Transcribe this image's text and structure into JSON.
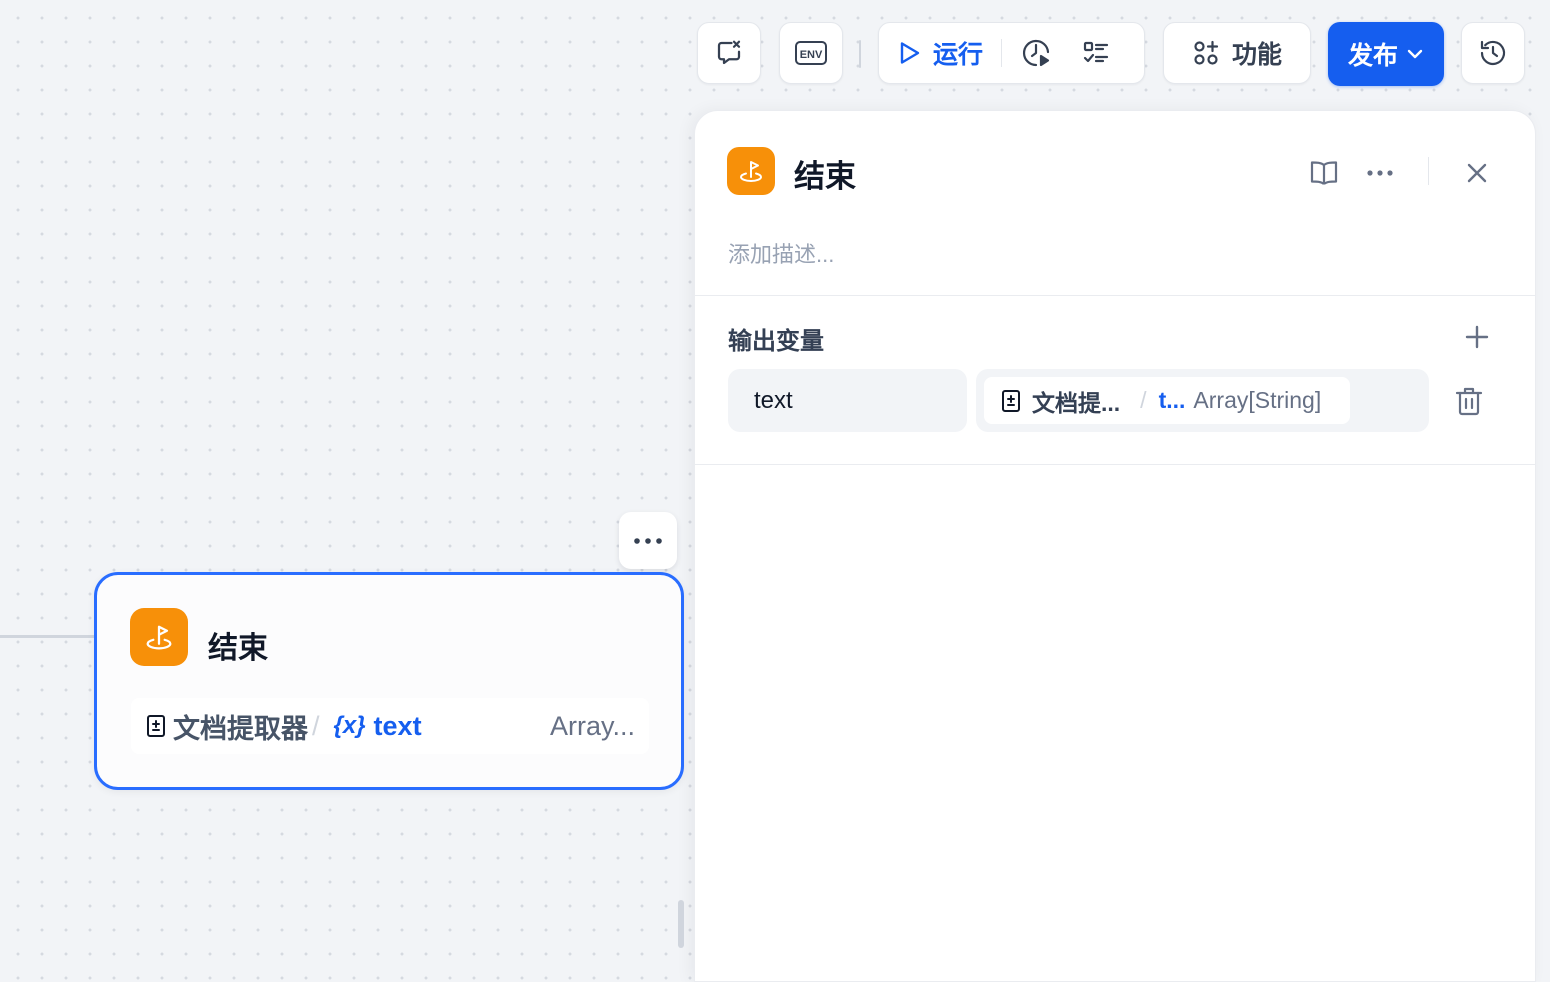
{
  "toolbar": {
    "check_icon": "checklist-x-icon",
    "env_label": "ENV",
    "run_label": "运行",
    "history_run_icon": "clock-play-icon",
    "checklist_icon": "list-check-icon",
    "feature_label": "功能",
    "publish_label": "发布",
    "version_history_icon": "history-icon"
  },
  "panel": {
    "title": "结束",
    "description_placeholder": "添加描述...",
    "output_section_title": "输出变量",
    "outputs": [
      {
        "name": "text",
        "source_node": "文档提...",
        "source_var": "t...",
        "type": "Array[String]",
        "separator": "/"
      }
    ]
  },
  "node": {
    "title": "结束",
    "var_source": "文档提取器",
    "separator": "/",
    "var_brace": "{x}",
    "var_name": "text",
    "var_type": "Array..."
  },
  "colors": {
    "accent": "#155eef",
    "node_icon": "#f79009",
    "selected_border": "#296dff"
  }
}
